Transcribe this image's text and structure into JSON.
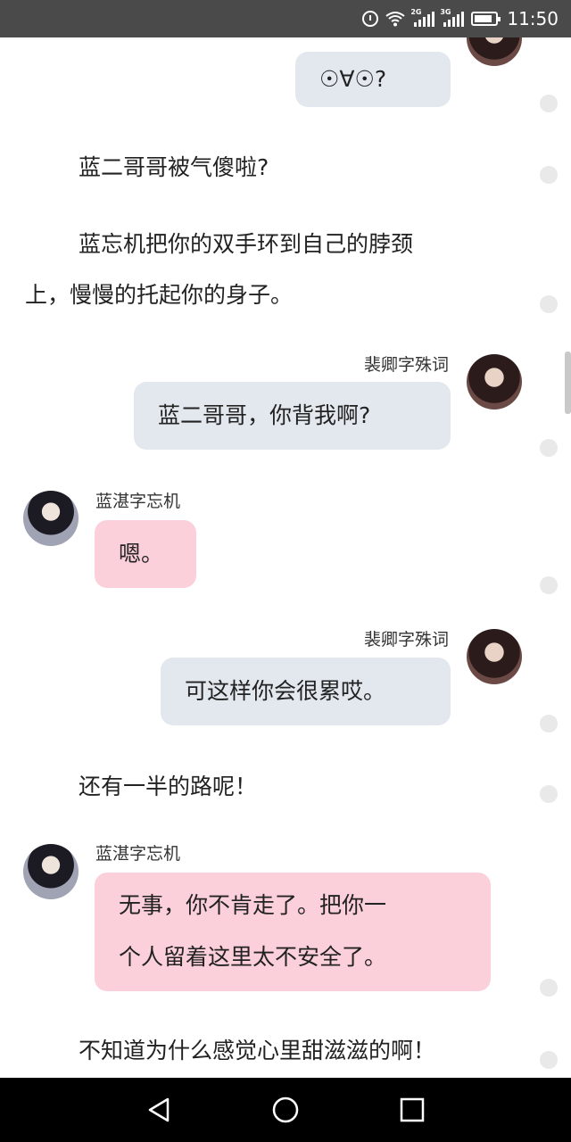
{
  "status_bar": {
    "time": "11:50",
    "network_labels": [
      "2G",
      "3G"
    ],
    "icons": [
      "alarm-icon",
      "wifi-icon",
      "signal-icon",
      "signal-icon",
      "battery-icon"
    ]
  },
  "chat": {
    "messages": [
      {
        "type": "bubble",
        "sender": "me",
        "text": "☉∀☉?"
      },
      {
        "type": "narration",
        "text": "蓝二哥哥被气傻啦?"
      },
      {
        "type": "narration",
        "line1": "蓝忘机把你的双手环到自己的脖颈",
        "line2": "上，慢慢的托起你的身子。"
      },
      {
        "type": "bubble",
        "sender": "me",
        "name": "裴卿字殊词",
        "text": "蓝二哥哥，你背我啊?"
      },
      {
        "type": "bubble",
        "sender": "him",
        "name": "蓝湛字忘机",
        "text": "嗯。"
      },
      {
        "type": "bubble",
        "sender": "me",
        "name": "裴卿字殊词",
        "text": "可这样你会很累哎。"
      },
      {
        "type": "narration",
        "text": "还有一半的路呢！"
      },
      {
        "type": "bubble",
        "sender": "him",
        "name": "蓝湛字忘机",
        "line1": "无事，你不肯走了。把你一",
        "line2": "个人留着这里太不安全了。"
      },
      {
        "type": "narration",
        "text": "不知道为什么感觉心里甜滋滋的啊！"
      }
    ]
  },
  "colors": {
    "status_bar": "#4a4a4a",
    "my_bubble": "#e3e8ef",
    "his_bubble": "#fcd0da",
    "nav_bar": "#000000"
  },
  "nav_bar": {
    "buttons": [
      "back-icon",
      "home-icon",
      "recents-icon"
    ]
  }
}
